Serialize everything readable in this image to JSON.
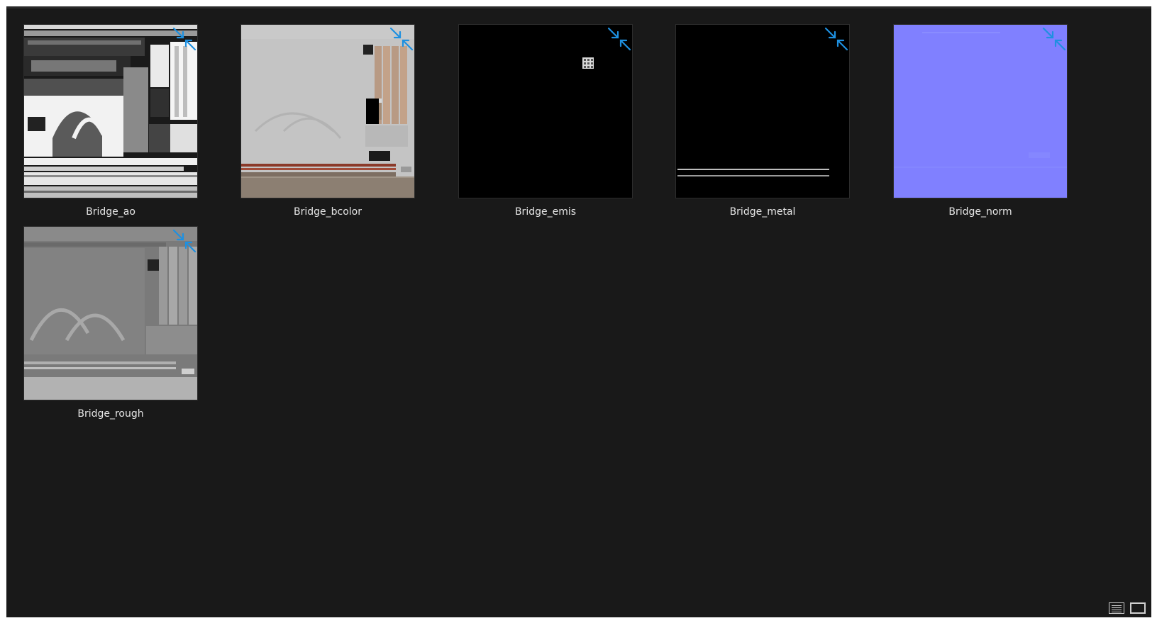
{
  "explorer": {
    "items": [
      {
        "name": "Bridge_ao",
        "icon": "compress-arrows-icon"
      },
      {
        "name": "Bridge_bcolor",
        "icon": "compress-arrows-icon"
      },
      {
        "name": "Bridge_emis",
        "icon": "compress-arrows-icon"
      },
      {
        "name": "Bridge_metal",
        "icon": "compress-arrows-icon"
      },
      {
        "name": "Bridge_norm",
        "icon": "compress-arrows-icon"
      },
      {
        "name": "Bridge_rough",
        "icon": "compress-arrows-icon"
      }
    ],
    "view_buttons": [
      {
        "icon": "details-view-icon"
      },
      {
        "icon": "large-icons-view-icon"
      }
    ]
  },
  "colors": {
    "background": "#191919",
    "text": "#e6e6e6",
    "compress_icon": "#1e90e0",
    "normal_map": "#8080ff"
  }
}
